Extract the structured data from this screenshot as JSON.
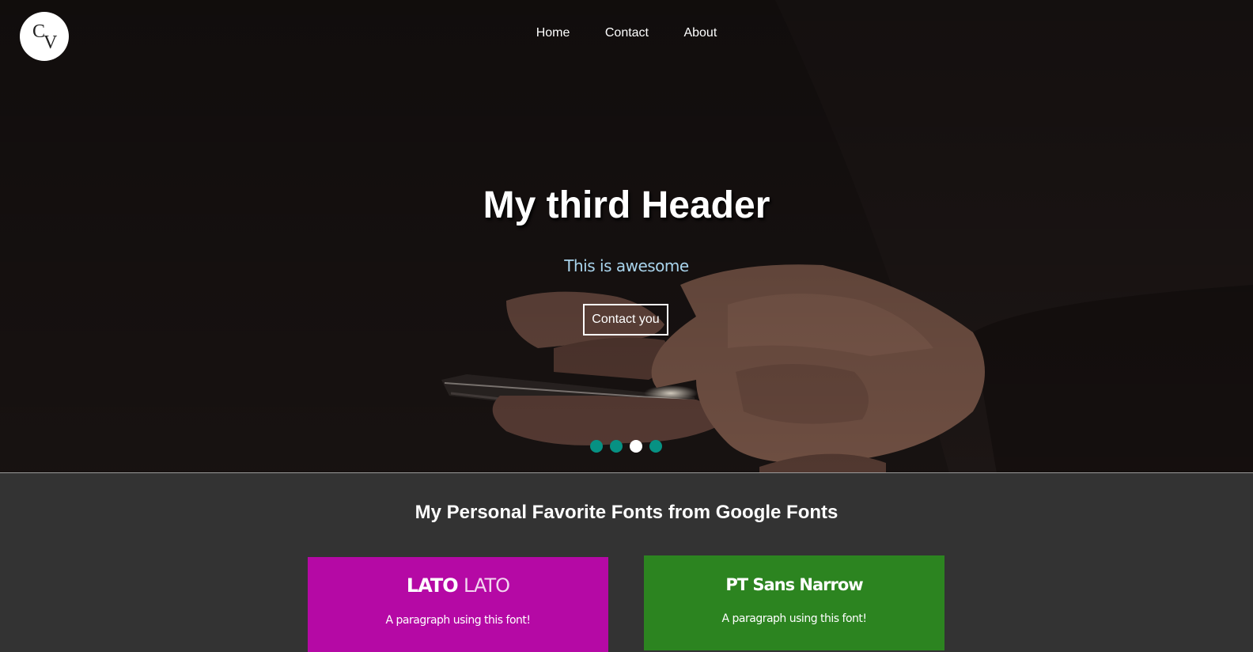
{
  "logo": {
    "letter_top": "C",
    "letter_bottom": "V"
  },
  "nav": {
    "items": [
      {
        "label": "Home"
      },
      {
        "label": "Contact"
      },
      {
        "label": "About"
      }
    ]
  },
  "hero": {
    "title": "My third Header",
    "subtitle": "This is awesome",
    "cta_label": "Contact you",
    "slides_total": 4,
    "active_slide": 3
  },
  "fonts_section": {
    "title": "My Personal Favorite Fonts from Google Fonts",
    "cards": [
      {
        "title_bold": "LATO",
        "title_light": "LATO",
        "text": "A paragraph using this font!",
        "color": "#b509a5"
      },
      {
        "title": "PT Sans Narrow",
        "text": "A paragraph using this font!",
        "color": "#2c8420"
      }
    ]
  },
  "colors": {
    "dot": "#079183",
    "dot_active": "#ffffff",
    "subtitle": "#a9d4ec",
    "section_bg": "#333333"
  }
}
